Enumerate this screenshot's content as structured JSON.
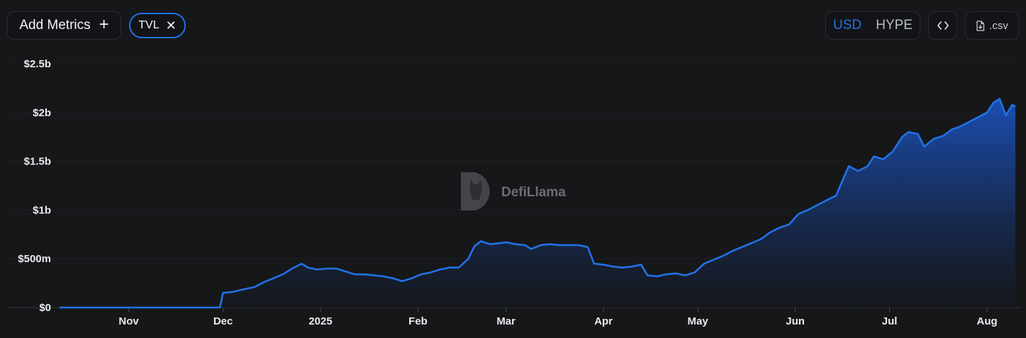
{
  "toolbar": {
    "add_metrics_label": "Add Metrics",
    "add_metrics_icon": "+",
    "metric_chip_label": "TVL",
    "metric_chip_close": "✕",
    "currency_options": [
      "USD",
      "HYPE"
    ],
    "selected_currency": "USD",
    "embed_icon": "code-icon",
    "csv_label": ".csv"
  },
  "watermark": {
    "text": "DefiLlama",
    "logo": "defillama-logo"
  },
  "colors": {
    "background": "#161719",
    "line": "#2172e5",
    "area_top": "#1c55c4",
    "area_bottom": "#14171d",
    "axis": "#2a2c31"
  },
  "chart_data": {
    "type": "area",
    "ylim": [
      0,
      2.5
    ],
    "y_unit": "billions USD",
    "ytick_values": [
      0,
      0.5,
      1,
      1.5,
      2,
      2.5
    ],
    "ytick_labels": [
      "$0",
      "$500m",
      "$1b",
      "$1.5b",
      "$2b",
      "$2.5b"
    ],
    "x_range": [
      "2024-10-10",
      "2025-08-10"
    ],
    "xticks": [
      {
        "date": "2024-11-01",
        "label": "Nov",
        "bold": false
      },
      {
        "date": "2024-12-01",
        "label": "Dec",
        "bold": false
      },
      {
        "date": "2025-01-01",
        "label": "2025",
        "bold": true
      },
      {
        "date": "2025-02-01",
        "label": "Feb",
        "bold": false
      },
      {
        "date": "2025-03-01",
        "label": "Mar",
        "bold": false
      },
      {
        "date": "2025-04-01",
        "label": "Apr",
        "bold": false
      },
      {
        "date": "2025-05-01",
        "label": "May",
        "bold": false
      },
      {
        "date": "2025-06-01",
        "label": "Jun",
        "bold": false
      },
      {
        "date": "2025-07-01",
        "label": "Jul",
        "bold": false
      },
      {
        "date": "2025-08-01",
        "label": "Aug",
        "bold": false
      }
    ],
    "grid": true,
    "series": [
      {
        "points": [
          [
            "2024-10-10",
            0
          ],
          [
            "2024-11-01",
            0
          ],
          [
            "2024-11-29",
            0
          ],
          [
            "2024-11-30",
            0
          ],
          [
            "2024-12-01",
            0.15
          ],
          [
            "2024-12-04",
            0.16
          ],
          [
            "2024-12-08",
            0.19
          ],
          [
            "2024-12-11",
            0.21
          ],
          [
            "2024-12-14",
            0.26
          ],
          [
            "2024-12-17",
            0.3
          ],
          [
            "2024-12-20",
            0.34
          ],
          [
            "2024-12-23",
            0.4
          ],
          [
            "2024-12-26",
            0.45
          ],
          [
            "2024-12-28",
            0.41
          ],
          [
            "2024-12-31",
            0.39
          ],
          [
            "2025-01-03",
            0.4
          ],
          [
            "2025-01-06",
            0.4
          ],
          [
            "2025-01-09",
            0.37
          ],
          [
            "2025-01-12",
            0.34
          ],
          [
            "2025-01-15",
            0.34
          ],
          [
            "2025-01-18",
            0.33
          ],
          [
            "2025-01-21",
            0.32
          ],
          [
            "2025-01-24",
            0.3
          ],
          [
            "2025-01-27",
            0.27
          ],
          [
            "2025-01-30",
            0.3
          ],
          [
            "2025-02-02",
            0.34
          ],
          [
            "2025-02-05",
            0.36
          ],
          [
            "2025-02-08",
            0.39
          ],
          [
            "2025-02-11",
            0.41
          ],
          [
            "2025-02-14",
            0.41
          ],
          [
            "2025-02-17",
            0.5
          ],
          [
            "2025-02-19",
            0.63
          ],
          [
            "2025-02-21",
            0.68
          ],
          [
            "2025-02-24",
            0.65
          ],
          [
            "2025-02-27",
            0.66
          ],
          [
            "2025-03-01",
            0.67
          ],
          [
            "2025-03-04",
            0.65
          ],
          [
            "2025-03-07",
            0.64
          ],
          [
            "2025-03-09",
            0.6
          ],
          [
            "2025-03-12",
            0.64
          ],
          [
            "2025-03-15",
            0.65
          ],
          [
            "2025-03-18",
            0.64
          ],
          [
            "2025-03-21",
            0.64
          ],
          [
            "2025-03-24",
            0.64
          ],
          [
            "2025-03-27",
            0.62
          ],
          [
            "2025-03-29",
            0.45
          ],
          [
            "2025-04-01",
            0.44
          ],
          [
            "2025-04-04",
            0.42
          ],
          [
            "2025-04-07",
            0.41
          ],
          [
            "2025-04-10",
            0.42
          ],
          [
            "2025-04-13",
            0.44
          ],
          [
            "2025-04-15",
            0.33
          ],
          [
            "2025-04-18",
            0.32
          ],
          [
            "2025-04-21",
            0.34
          ],
          [
            "2025-04-24",
            0.35
          ],
          [
            "2025-04-27",
            0.33
          ],
          [
            "2025-04-30",
            0.36
          ],
          [
            "2025-05-03",
            0.45
          ],
          [
            "2025-05-06",
            0.49
          ],
          [
            "2025-05-09",
            0.53
          ],
          [
            "2025-05-12",
            0.58
          ],
          [
            "2025-05-15",
            0.62
          ],
          [
            "2025-05-18",
            0.66
          ],
          [
            "2025-05-21",
            0.7
          ],
          [
            "2025-05-24",
            0.77
          ],
          [
            "2025-05-27",
            0.82
          ],
          [
            "2025-05-30",
            0.85
          ],
          [
            "2025-06-02",
            0.96
          ],
          [
            "2025-06-05",
            1.0
          ],
          [
            "2025-06-08",
            1.05
          ],
          [
            "2025-06-11",
            1.1
          ],
          [
            "2025-06-14",
            1.15
          ],
          [
            "2025-06-16",
            1.3
          ],
          [
            "2025-06-18",
            1.45
          ],
          [
            "2025-06-21",
            1.4
          ],
          [
            "2025-06-24",
            1.45
          ],
          [
            "2025-06-26",
            1.55
          ],
          [
            "2025-06-29",
            1.52
          ],
          [
            "2025-07-02",
            1.6
          ],
          [
            "2025-07-05",
            1.75
          ],
          [
            "2025-07-07",
            1.8
          ],
          [
            "2025-07-10",
            1.78
          ],
          [
            "2025-07-12",
            1.65
          ],
          [
            "2025-07-15",
            1.73
          ],
          [
            "2025-07-18",
            1.76
          ],
          [
            "2025-07-21",
            1.83
          ],
          [
            "2025-07-23",
            1.85
          ],
          [
            "2025-07-26",
            1.9
          ],
          [
            "2025-07-29",
            1.95
          ],
          [
            "2025-08-01",
            2.0
          ],
          [
            "2025-08-03",
            2.1
          ],
          [
            "2025-08-05",
            2.14
          ],
          [
            "2025-08-07",
            1.97
          ],
          [
            "2025-08-09",
            2.08
          ],
          [
            "2025-08-10",
            2.06
          ]
        ]
      }
    ]
  }
}
